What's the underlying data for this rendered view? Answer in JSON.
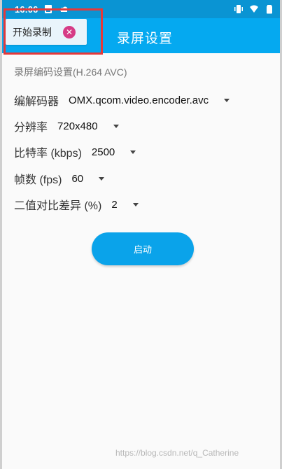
{
  "status_bar": {
    "time": "16:06",
    "left_icons": [
      "sim-icon",
      "cloud-icon"
    ],
    "right_icons": [
      "vibrate-icon",
      "wifi-icon",
      "battery-icon"
    ]
  },
  "app_bar": {
    "title": "录屏设置"
  },
  "floating_chip": {
    "label": "开始录制",
    "close_icon": "close-icon",
    "highlight_color": "#e5393a"
  },
  "section": {
    "title": "录屏编码设置(H.264 AVC)"
  },
  "settings": [
    {
      "label": "编解码器",
      "value": "OMX.qcom.video.encoder.avc"
    },
    {
      "label": "分辨率",
      "value": "720x480"
    },
    {
      "label": "比特率 (kbps)",
      "value": "2500"
    },
    {
      "label": "帧数 (fps)",
      "value": "60"
    },
    {
      "label": "二值对比差异 (%)",
      "value": "2"
    }
  ],
  "start_button": {
    "label": "启动"
  },
  "watermark": "https://blog.csdn.net/q_Catherine",
  "colors": {
    "status_bar": "#0a94d3",
    "app_bar": "#05a9f0",
    "primary_button": "#0aa3ea",
    "close_button": "#d63b86"
  }
}
